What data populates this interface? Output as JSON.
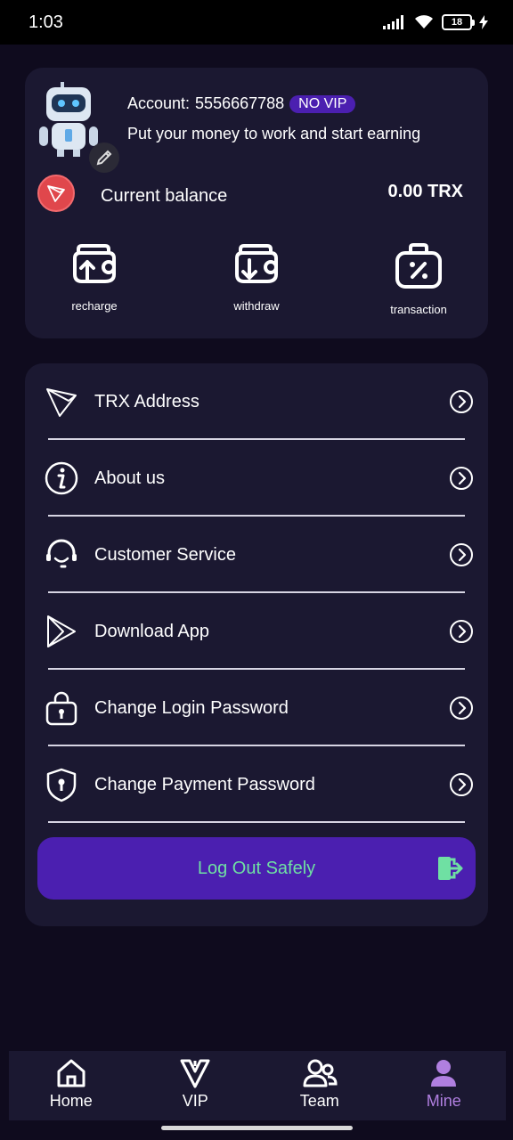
{
  "status_bar": {
    "time": "1:03",
    "battery": "18"
  },
  "account": {
    "label": "Account:",
    "number": "5556667788",
    "vip_badge": "NO VIP",
    "tagline": "Put your money to work and start earning",
    "balance_label": "Current balance",
    "balance_value": "0.00 TRX"
  },
  "actions": [
    {
      "label": "recharge",
      "icon": "recharge-icon"
    },
    {
      "label": "withdraw",
      "icon": "withdraw-icon"
    },
    {
      "label": "transaction",
      "icon": "transaction-icon"
    }
  ],
  "menu": [
    {
      "label": "TRX Address",
      "icon": "tron-icon"
    },
    {
      "label": "About us",
      "icon": "info-icon"
    },
    {
      "label": "Customer Service",
      "icon": "headset-icon"
    },
    {
      "label": "Download App",
      "icon": "play-icon"
    },
    {
      "label": "Change Login Password",
      "icon": "lock-icon"
    },
    {
      "label": "Change Payment Password",
      "icon": "shield-icon"
    }
  ],
  "logout": {
    "label": "Log Out Safely"
  },
  "tabs": [
    {
      "label": "Home",
      "icon": "home-icon"
    },
    {
      "label": "VIP",
      "icon": "vip-icon"
    },
    {
      "label": "Team",
      "icon": "team-icon"
    },
    {
      "label": "Mine",
      "icon": "user-icon",
      "active": true
    }
  ],
  "colors": {
    "background": "#0f0b1e",
    "card": "#1b1831",
    "accent": "#4b1fb0",
    "logout_text": "#6fe0a3",
    "active_tab": "#b07fe0"
  }
}
